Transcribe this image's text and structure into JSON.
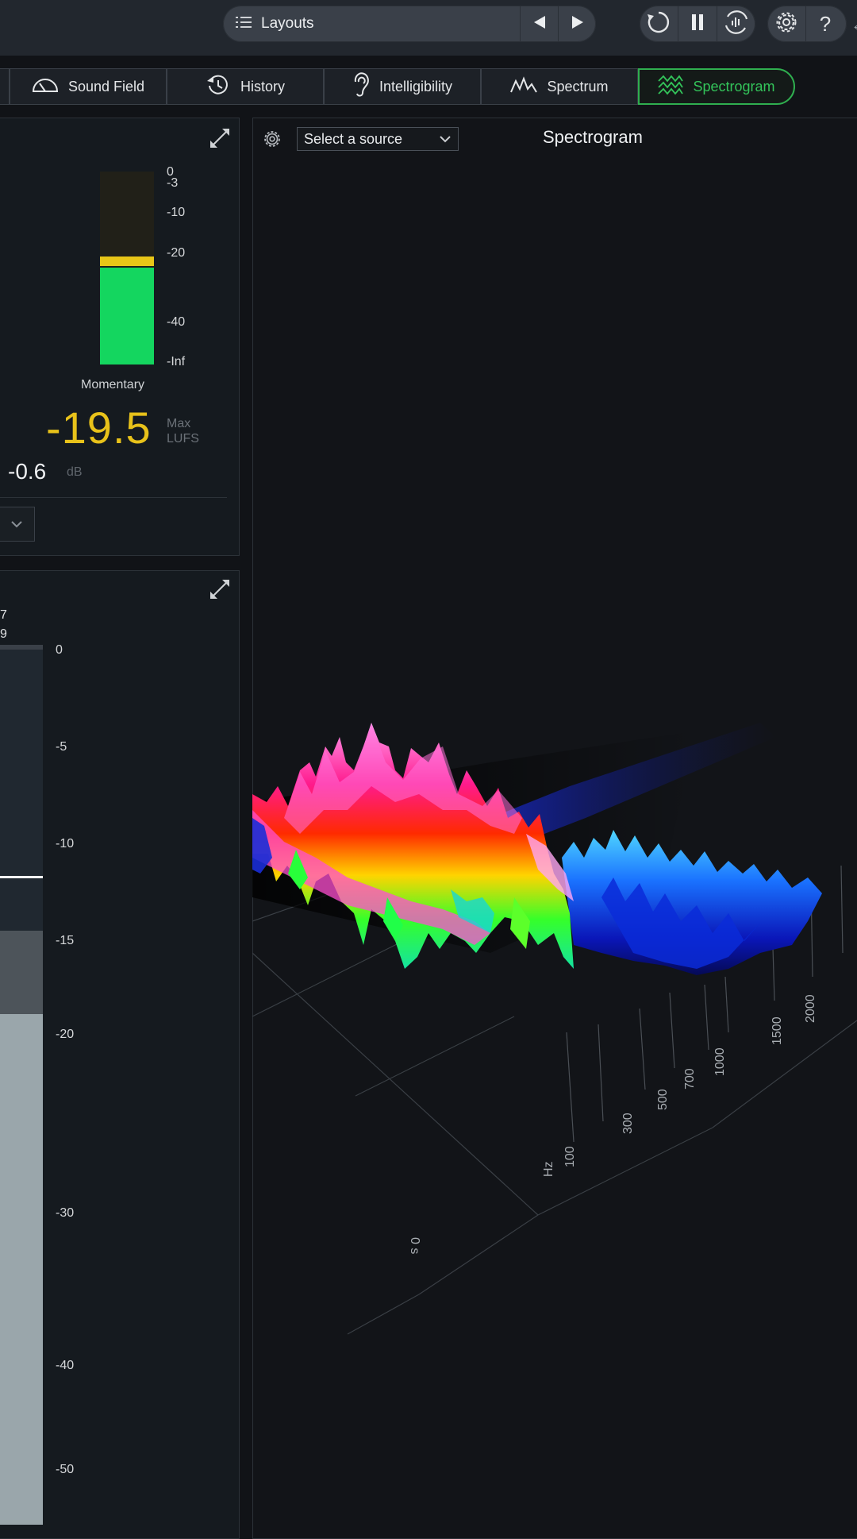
{
  "topbar": {
    "layouts_label": "Layouts",
    "icons": [
      "list-icon",
      "prev-icon",
      "next-icon",
      "loop-icon",
      "pause-icon",
      "capture-icon",
      "gear-icon",
      "help-icon"
    ],
    "help_glyph": "?"
  },
  "tabs": [
    {
      "label": "Sound Field",
      "icon": "gauge-icon"
    },
    {
      "label": "History",
      "icon": "history-icon"
    },
    {
      "label": "Intelligibility",
      "icon": "ear-icon"
    },
    {
      "label": "Spectrum",
      "icon": "spectrum-icon"
    },
    {
      "label": "Spectrogram",
      "icon": "spectrogram-icon",
      "active": true
    }
  ],
  "loudness": {
    "scale": [
      "0",
      "-3",
      "-10",
      "-20",
      "-40",
      "-Inf"
    ],
    "meter_level_fraction": 0.5,
    "label": "Momentary",
    "value": "-19.5",
    "unit_max": "Max",
    "unit_lufs": "LUFS",
    "true_peak": "-0.6",
    "true_peak_unit": "dB"
  },
  "levels": {
    "header_line1": "7",
    "header_line2": "9",
    "scale": [
      "0",
      "-5",
      "-10",
      "-15",
      "-20",
      "-30",
      "-40",
      "-50"
    ]
  },
  "spectrogram": {
    "source_placeholder": "Select a source",
    "title": "Spectrogram",
    "hz_ticks": [
      "100",
      "300",
      "500",
      "700",
      "1000",
      "1500",
      "2000"
    ],
    "hz_unit": "Hz",
    "time_label": "0 s"
  },
  "colors": {
    "accent_green": "#33c45a",
    "loudness_yellow": "#e8c21a",
    "meter_green": "#14d65f"
  }
}
